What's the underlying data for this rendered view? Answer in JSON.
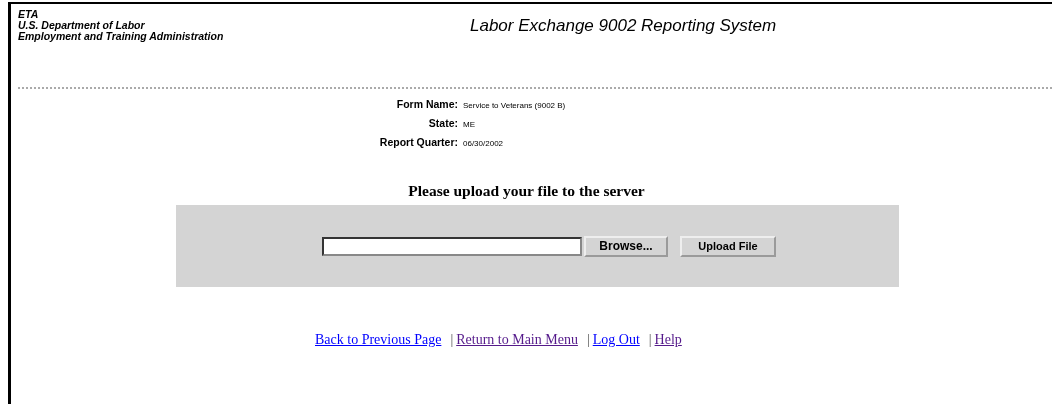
{
  "header": {
    "agency_lines": [
      "ETA",
      "U.S. Department of Labor",
      "Employment and Training Administration"
    ],
    "title": "Labor Exchange 9002 Reporting System"
  },
  "form_info": [
    {
      "label": "Form Name:",
      "value": "Service to Veterans (9002 B)"
    },
    {
      "label": "State:",
      "value": "ME"
    },
    {
      "label": "Report Quarter:",
      "value": "06/30/2002"
    }
  ],
  "upload": {
    "heading": "Please upload your file to the server",
    "browse_button": "Browse...",
    "upload_button": "Upload File"
  },
  "links": [
    {
      "label": "Back to Previous Page",
      "visited": false
    },
    {
      "label": "Return to Main Menu",
      "visited": true
    },
    {
      "label": "Log Out",
      "visited": false
    },
    {
      "label": "Help",
      "visited": true
    }
  ],
  "separator": "|"
}
